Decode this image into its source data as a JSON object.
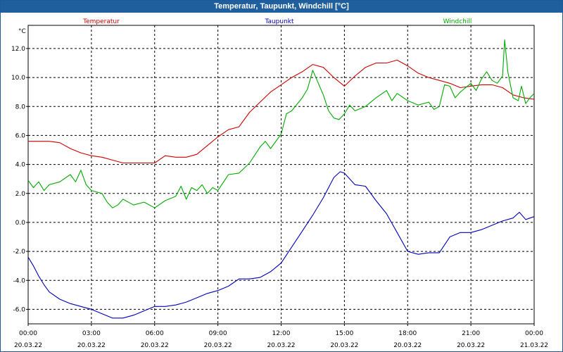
{
  "window": {
    "title": "Temperatur, Taupunkt, Windchill [°C]"
  },
  "colors": {
    "temperatur": "#cc0000",
    "taupunkt": "#0000bb",
    "windchill": "#00aa00",
    "titlebar": "#1f5f9e"
  },
  "chart_data": {
    "type": "line",
    "title": "Temperatur, Taupunkt, Windchill [°C]",
    "ylabel": "°C",
    "xlabel": "",
    "ylim": [
      -7.0,
      13.6
    ],
    "xlim": [
      0,
      24
    ],
    "grid": true,
    "legend_placement": "top",
    "y_ticks": [
      "-6.0",
      "-4.0",
      "-2.0",
      "0.0",
      "2.0",
      "4.0",
      "6.0",
      "8.0",
      "10.0",
      "12.0"
    ],
    "x_ticks": [
      {
        "time": "00:00",
        "date": "20.03.22"
      },
      {
        "time": "03:00",
        "date": "20.03.22"
      },
      {
        "time": "06:00",
        "date": "20.03.22"
      },
      {
        "time": "09:00",
        "date": "20.03.22"
      },
      {
        "time": "12:00",
        "date": "20.03.22"
      },
      {
        "time": "15:00",
        "date": "20.03.22"
      },
      {
        "time": "18:00",
        "date": "20.03.22"
      },
      {
        "time": "21:00",
        "date": "20.03.22"
      },
      {
        "time": "00:00",
        "date": "21.03.22"
      }
    ],
    "series": [
      {
        "name": "Temperatur",
        "color": "#cc0000",
        "points": [
          [
            0.0,
            5.6
          ],
          [
            0.5,
            5.6
          ],
          [
            1.0,
            5.6
          ],
          [
            1.5,
            5.5
          ],
          [
            2.0,
            5.1
          ],
          [
            2.5,
            4.8
          ],
          [
            3.0,
            4.6
          ],
          [
            3.5,
            4.5
          ],
          [
            4.0,
            4.3
          ],
          [
            4.5,
            4.1
          ],
          [
            5.0,
            4.1
          ],
          [
            5.5,
            4.1
          ],
          [
            6.0,
            4.1
          ],
          [
            6.5,
            4.6
          ],
          [
            7.0,
            4.5
          ],
          [
            7.5,
            4.5
          ],
          [
            8.0,
            4.7
          ],
          [
            8.5,
            5.3
          ],
          [
            9.0,
            5.9
          ],
          [
            9.5,
            6.4
          ],
          [
            10.0,
            6.6
          ],
          [
            10.5,
            7.6
          ],
          [
            11.0,
            8.3
          ],
          [
            11.5,
            9.0
          ],
          [
            12.0,
            9.5
          ],
          [
            12.5,
            10.0
          ],
          [
            13.0,
            10.4
          ],
          [
            13.5,
            10.9
          ],
          [
            14.0,
            10.7
          ],
          [
            14.5,
            10.0
          ],
          [
            15.0,
            9.4
          ],
          [
            15.5,
            10.1
          ],
          [
            16.0,
            10.7
          ],
          [
            16.5,
            11.0
          ],
          [
            17.0,
            11.0
          ],
          [
            17.5,
            11.2
          ],
          [
            18.0,
            10.8
          ],
          [
            18.5,
            10.3
          ],
          [
            19.0,
            10.0
          ],
          [
            19.5,
            9.8
          ],
          [
            20.0,
            9.6
          ],
          [
            20.5,
            9.3
          ],
          [
            21.0,
            9.4
          ],
          [
            21.5,
            9.5
          ],
          [
            22.0,
            9.5
          ],
          [
            22.5,
            9.3
          ],
          [
            23.0,
            8.8
          ],
          [
            23.5,
            8.6
          ],
          [
            24.0,
            8.5
          ]
        ]
      },
      {
        "name": "Taupunkt",
        "color": "#0000bb",
        "points": [
          [
            0.0,
            -2.4
          ],
          [
            0.25,
            -3.0
          ],
          [
            0.5,
            -3.7
          ],
          [
            0.75,
            -4.3
          ],
          [
            1.0,
            -4.8
          ],
          [
            1.5,
            -5.3
          ],
          [
            2.0,
            -5.6
          ],
          [
            2.5,
            -5.8
          ],
          [
            3.0,
            -6.0
          ],
          [
            3.5,
            -6.3
          ],
          [
            4.0,
            -6.6
          ],
          [
            4.5,
            -6.6
          ],
          [
            5.0,
            -6.4
          ],
          [
            5.5,
            -6.1
          ],
          [
            6.0,
            -5.8
          ],
          [
            6.5,
            -5.8
          ],
          [
            7.0,
            -5.7
          ],
          [
            7.5,
            -5.5
          ],
          [
            8.0,
            -5.2
          ],
          [
            8.5,
            -4.9
          ],
          [
            9.0,
            -4.7
          ],
          [
            9.5,
            -4.4
          ],
          [
            10.0,
            -3.9
          ],
          [
            10.5,
            -3.9
          ],
          [
            11.0,
            -3.8
          ],
          [
            11.5,
            -3.4
          ],
          [
            12.0,
            -2.8
          ],
          [
            12.5,
            -1.7
          ],
          [
            13.0,
            -0.6
          ],
          [
            13.5,
            0.5
          ],
          [
            14.0,
            1.7
          ],
          [
            14.5,
            3.1
          ],
          [
            14.8,
            3.5
          ],
          [
            15.0,
            3.4
          ],
          [
            15.5,
            2.6
          ],
          [
            16.0,
            2.5
          ],
          [
            16.5,
            1.5
          ],
          [
            17.0,
            0.6
          ],
          [
            17.5,
            -0.7
          ],
          [
            18.0,
            -2.0
          ],
          [
            18.5,
            -2.2
          ],
          [
            19.0,
            -2.1
          ],
          [
            19.5,
            -2.1
          ],
          [
            20.0,
            -1.0
          ],
          [
            20.5,
            -0.7
          ],
          [
            21.0,
            -0.7
          ],
          [
            21.5,
            -0.5
          ],
          [
            22.0,
            -0.2
          ],
          [
            22.5,
            0.1
          ],
          [
            23.0,
            0.3
          ],
          [
            23.3,
            0.7
          ],
          [
            23.6,
            0.2
          ],
          [
            24.0,
            0.4
          ]
        ]
      },
      {
        "name": "Windchill",
        "color": "#00aa00",
        "points": [
          [
            0.0,
            2.9
          ],
          [
            0.25,
            2.4
          ],
          [
            0.5,
            2.8
          ],
          [
            0.75,
            2.2
          ],
          [
            1.0,
            2.6
          ],
          [
            1.5,
            2.8
          ],
          [
            2.0,
            3.3
          ],
          [
            2.25,
            2.8
          ],
          [
            2.5,
            3.6
          ],
          [
            2.75,
            2.6
          ],
          [
            3.0,
            2.2
          ],
          [
            3.5,
            2.0
          ],
          [
            3.75,
            1.4
          ],
          [
            4.0,
            1.0
          ],
          [
            4.25,
            1.2
          ],
          [
            4.5,
            1.6
          ],
          [
            5.0,
            1.2
          ],
          [
            5.5,
            1.4
          ],
          [
            6.0,
            1.0
          ],
          [
            6.5,
            1.5
          ],
          [
            7.0,
            1.8
          ],
          [
            7.25,
            2.5
          ],
          [
            7.5,
            1.6
          ],
          [
            7.75,
            2.4
          ],
          [
            8.0,
            2.2
          ],
          [
            8.25,
            2.6
          ],
          [
            8.5,
            2.0
          ],
          [
            8.75,
            2.4
          ],
          [
            9.0,
            2.2
          ],
          [
            9.5,
            3.3
          ],
          [
            10.0,
            3.4
          ],
          [
            10.5,
            4.1
          ],
          [
            11.0,
            5.2
          ],
          [
            11.25,
            5.6
          ],
          [
            11.5,
            5.1
          ],
          [
            12.0,
            6.1
          ],
          [
            12.25,
            7.5
          ],
          [
            12.5,
            7.7
          ],
          [
            13.0,
            8.6
          ],
          [
            13.25,
            9.2
          ],
          [
            13.5,
            10.5
          ],
          [
            14.0,
            8.8
          ],
          [
            14.25,
            7.7
          ],
          [
            14.5,
            7.2
          ],
          [
            14.75,
            7.1
          ],
          [
            15.0,
            7.5
          ],
          [
            15.25,
            8.1
          ],
          [
            15.5,
            7.7
          ],
          [
            16.0,
            8.0
          ],
          [
            16.5,
            8.6
          ],
          [
            17.0,
            9.1
          ],
          [
            17.25,
            8.4
          ],
          [
            17.5,
            8.9
          ],
          [
            18.0,
            8.4
          ],
          [
            18.5,
            8.1
          ],
          [
            19.0,
            8.3
          ],
          [
            19.25,
            7.8
          ],
          [
            19.5,
            8.0
          ],
          [
            19.75,
            9.5
          ],
          [
            20.0,
            9.4
          ],
          [
            20.25,
            8.6
          ],
          [
            20.5,
            9.0
          ],
          [
            20.75,
            9.3
          ],
          [
            21.0,
            9.6
          ],
          [
            21.25,
            9.1
          ],
          [
            21.5,
            9.9
          ],
          [
            21.75,
            10.4
          ],
          [
            22.0,
            9.8
          ],
          [
            22.25,
            9.6
          ],
          [
            22.5,
            10.1
          ],
          [
            22.6,
            12.6
          ],
          [
            22.75,
            10.4
          ],
          [
            23.0,
            8.6
          ],
          [
            23.25,
            8.4
          ],
          [
            23.4,
            9.4
          ],
          [
            23.6,
            8.2
          ],
          [
            23.8,
            8.6
          ],
          [
            24.0,
            8.9
          ]
        ]
      }
    ]
  }
}
